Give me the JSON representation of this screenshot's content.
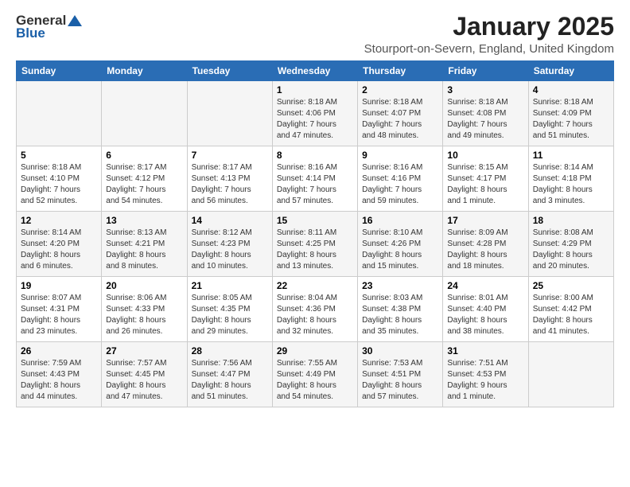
{
  "logo": {
    "general": "General",
    "blue": "Blue"
  },
  "title": "January 2025",
  "location": "Stourport-on-Severn, England, United Kingdom",
  "headers": [
    "Sunday",
    "Monday",
    "Tuesday",
    "Wednesday",
    "Thursday",
    "Friday",
    "Saturday"
  ],
  "weeks": [
    [
      {
        "day": "",
        "info": ""
      },
      {
        "day": "",
        "info": ""
      },
      {
        "day": "",
        "info": ""
      },
      {
        "day": "1",
        "info": "Sunrise: 8:18 AM\nSunset: 4:06 PM\nDaylight: 7 hours\nand 47 minutes."
      },
      {
        "day": "2",
        "info": "Sunrise: 8:18 AM\nSunset: 4:07 PM\nDaylight: 7 hours\nand 48 minutes."
      },
      {
        "day": "3",
        "info": "Sunrise: 8:18 AM\nSunset: 4:08 PM\nDaylight: 7 hours\nand 49 minutes."
      },
      {
        "day": "4",
        "info": "Sunrise: 8:18 AM\nSunset: 4:09 PM\nDaylight: 7 hours\nand 51 minutes."
      }
    ],
    [
      {
        "day": "5",
        "info": "Sunrise: 8:18 AM\nSunset: 4:10 PM\nDaylight: 7 hours\nand 52 minutes."
      },
      {
        "day": "6",
        "info": "Sunrise: 8:17 AM\nSunset: 4:12 PM\nDaylight: 7 hours\nand 54 minutes."
      },
      {
        "day": "7",
        "info": "Sunrise: 8:17 AM\nSunset: 4:13 PM\nDaylight: 7 hours\nand 56 minutes."
      },
      {
        "day": "8",
        "info": "Sunrise: 8:16 AM\nSunset: 4:14 PM\nDaylight: 7 hours\nand 57 minutes."
      },
      {
        "day": "9",
        "info": "Sunrise: 8:16 AM\nSunset: 4:16 PM\nDaylight: 7 hours\nand 59 minutes."
      },
      {
        "day": "10",
        "info": "Sunrise: 8:15 AM\nSunset: 4:17 PM\nDaylight: 8 hours\nand 1 minute."
      },
      {
        "day": "11",
        "info": "Sunrise: 8:14 AM\nSunset: 4:18 PM\nDaylight: 8 hours\nand 3 minutes."
      }
    ],
    [
      {
        "day": "12",
        "info": "Sunrise: 8:14 AM\nSunset: 4:20 PM\nDaylight: 8 hours\nand 6 minutes."
      },
      {
        "day": "13",
        "info": "Sunrise: 8:13 AM\nSunset: 4:21 PM\nDaylight: 8 hours\nand 8 minutes."
      },
      {
        "day": "14",
        "info": "Sunrise: 8:12 AM\nSunset: 4:23 PM\nDaylight: 8 hours\nand 10 minutes."
      },
      {
        "day": "15",
        "info": "Sunrise: 8:11 AM\nSunset: 4:25 PM\nDaylight: 8 hours\nand 13 minutes."
      },
      {
        "day": "16",
        "info": "Sunrise: 8:10 AM\nSunset: 4:26 PM\nDaylight: 8 hours\nand 15 minutes."
      },
      {
        "day": "17",
        "info": "Sunrise: 8:09 AM\nSunset: 4:28 PM\nDaylight: 8 hours\nand 18 minutes."
      },
      {
        "day": "18",
        "info": "Sunrise: 8:08 AM\nSunset: 4:29 PM\nDaylight: 8 hours\nand 20 minutes."
      }
    ],
    [
      {
        "day": "19",
        "info": "Sunrise: 8:07 AM\nSunset: 4:31 PM\nDaylight: 8 hours\nand 23 minutes."
      },
      {
        "day": "20",
        "info": "Sunrise: 8:06 AM\nSunset: 4:33 PM\nDaylight: 8 hours\nand 26 minutes."
      },
      {
        "day": "21",
        "info": "Sunrise: 8:05 AM\nSunset: 4:35 PM\nDaylight: 8 hours\nand 29 minutes."
      },
      {
        "day": "22",
        "info": "Sunrise: 8:04 AM\nSunset: 4:36 PM\nDaylight: 8 hours\nand 32 minutes."
      },
      {
        "day": "23",
        "info": "Sunrise: 8:03 AM\nSunset: 4:38 PM\nDaylight: 8 hours\nand 35 minutes."
      },
      {
        "day": "24",
        "info": "Sunrise: 8:01 AM\nSunset: 4:40 PM\nDaylight: 8 hours\nand 38 minutes."
      },
      {
        "day": "25",
        "info": "Sunrise: 8:00 AM\nSunset: 4:42 PM\nDaylight: 8 hours\nand 41 minutes."
      }
    ],
    [
      {
        "day": "26",
        "info": "Sunrise: 7:59 AM\nSunset: 4:43 PM\nDaylight: 8 hours\nand 44 minutes."
      },
      {
        "day": "27",
        "info": "Sunrise: 7:57 AM\nSunset: 4:45 PM\nDaylight: 8 hours\nand 47 minutes."
      },
      {
        "day": "28",
        "info": "Sunrise: 7:56 AM\nSunset: 4:47 PM\nDaylight: 8 hours\nand 51 minutes."
      },
      {
        "day": "29",
        "info": "Sunrise: 7:55 AM\nSunset: 4:49 PM\nDaylight: 8 hours\nand 54 minutes."
      },
      {
        "day": "30",
        "info": "Sunrise: 7:53 AM\nSunset: 4:51 PM\nDaylight: 8 hours\nand 57 minutes."
      },
      {
        "day": "31",
        "info": "Sunrise: 7:51 AM\nSunset: 4:53 PM\nDaylight: 9 hours\nand 1 minute."
      },
      {
        "day": "",
        "info": ""
      }
    ]
  ]
}
